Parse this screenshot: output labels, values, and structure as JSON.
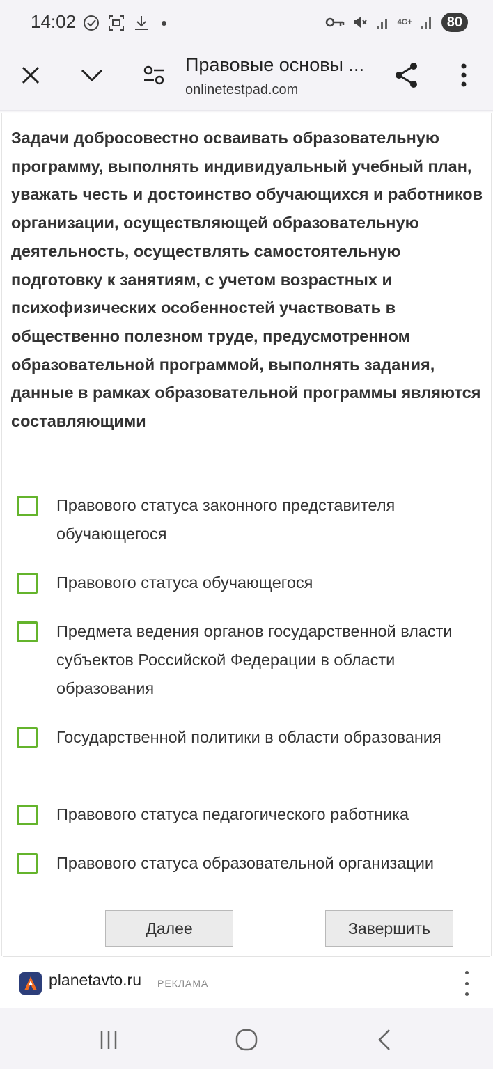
{
  "status_bar": {
    "time": "14:02",
    "battery": "80",
    "network_label": "4G+"
  },
  "browser": {
    "title": "Правовые основы ...",
    "url": "onlinetestpad.com"
  },
  "question": {
    "text": "Задачи добросовестно осваивать образовательную программу, выполнять индивидуальный учебный план, уважать честь и достоинство обучающихся и работников организации, осуществляющей образовательную деятельность, осуществлять самостоятельную подготовку к занятиям, с учетом возрастных и психофизических особенностей участвовать в общественно полезном труде, предусмотренном образовательной программой, выполнять задания, данные в рамках образовательной программы являются составляющими"
  },
  "options": [
    {
      "label": "Правового статуса законного представителя обучающегося",
      "checked": false
    },
    {
      "label": "Правового статуса обучающегося",
      "checked": false
    },
    {
      "label": "Предмета ведения органов государственной власти субъектов Российской Федерации в области образования",
      "checked": false
    },
    {
      "label": "Государственной политики в области образования",
      "checked": false
    },
    {
      "label": "Правового статуса педагогического работника",
      "checked": false
    },
    {
      "label": "Правового статуса образовательной организации",
      "checked": false
    }
  ],
  "buttons": {
    "next": "Далее",
    "finish": "Завершить"
  },
  "ad": {
    "site": "planetavto.ru",
    "tag": "РЕКЛАМА"
  },
  "colors": {
    "checkbox_border": "#64b42c",
    "chrome_bg": "#f4f3f7"
  }
}
